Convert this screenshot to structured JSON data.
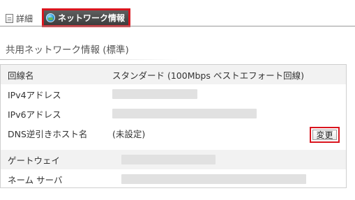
{
  "tabs": [
    {
      "label": "詳細",
      "icon": "document-icon",
      "active": false
    },
    {
      "label": "ネットワーク情報",
      "icon": "globe-icon",
      "active": true
    }
  ],
  "section_title": "共用ネットワーク情報 (標準)",
  "rows": [
    {
      "label": "回線名",
      "value": "スタンダード (100Mbps ベストエフォート回線)"
    },
    {
      "label": "IPv4アドレス",
      "value": ""
    },
    {
      "label": "IPv6アドレス",
      "value": ""
    },
    {
      "label": "DNS逆引きホスト名",
      "value": "(未設定)",
      "button": "変更"
    },
    {
      "label": "ゲートウェイ",
      "value": ""
    },
    {
      "label": "ネーム サーバ",
      "value": ""
    }
  ],
  "colors": {
    "highlight": "#d9151e",
    "active_tab_bg": "#4a4a4a",
    "row_shade": "#f2f2f2"
  }
}
